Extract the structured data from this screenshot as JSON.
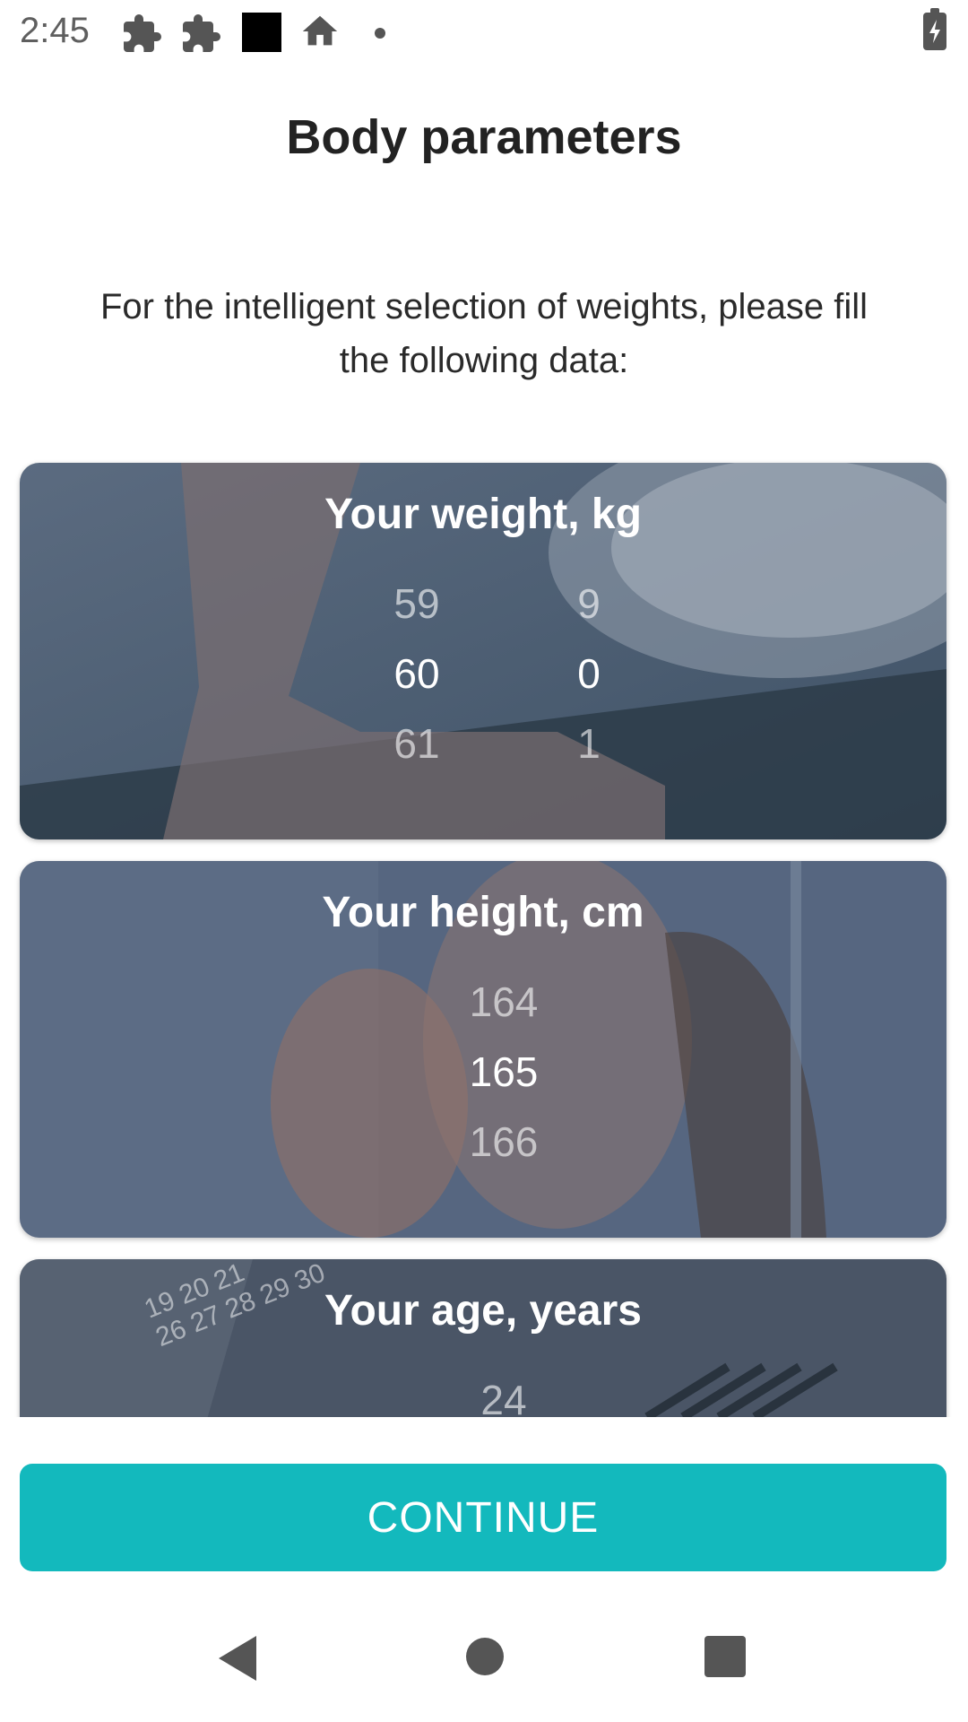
{
  "status_bar": {
    "time": "2:45",
    "icons": [
      "puzzle-icon",
      "puzzle-icon",
      "black-square-icon",
      "home-icon",
      "dot-icon",
      "battery-charging-icon"
    ]
  },
  "header": {
    "title": "Body parameters",
    "subtitle": "For the intelligent selection of weights, please fill the following data:"
  },
  "cards": {
    "weight": {
      "title": "Your weight, kg",
      "integer_picker": {
        "prev": "59",
        "selected": "60",
        "next": "61"
      },
      "decimal_picker": {
        "prev": "9",
        "selected": "0",
        "next": "1"
      }
    },
    "height": {
      "title": "Your height, cm",
      "picker": {
        "prev": "164",
        "selected": "165",
        "next": "166"
      }
    },
    "age": {
      "title": "Your age, years",
      "picker": {
        "prev": "24"
      },
      "calendar_numbers": [
        "19",
        "20",
        "21",
        "26",
        "27",
        "28",
        "29",
        "30"
      ]
    }
  },
  "footer": {
    "continue_label": "CONTINUE"
  },
  "nav": {
    "icons": [
      "back-icon",
      "home-circle-icon",
      "recents-icon"
    ]
  },
  "colors": {
    "accent": "#13b9bd",
    "card_overlay": "#4a5a72"
  }
}
